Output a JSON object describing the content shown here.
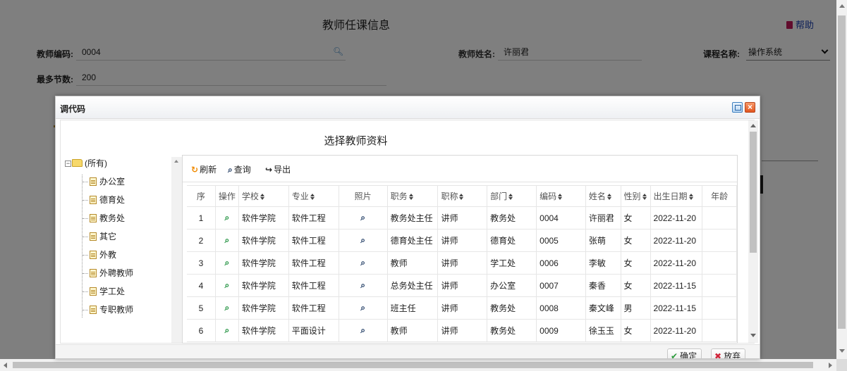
{
  "page": {
    "title": "教师任课信息",
    "help_label": "帮助",
    "fields": {
      "teacher_code_label": "教师编码:",
      "teacher_code_value": "0004",
      "teacher_name_label": "教师姓名:",
      "teacher_name_value": "许丽君",
      "course_label": "课程名称:",
      "course_value": "操作系统",
      "max_sessions_label": "最多节数:",
      "max_sessions_value": "200"
    }
  },
  "dialog": {
    "title": "调代码",
    "inner_title": "选择教师资料",
    "tree": {
      "root": "(所有)",
      "items": [
        "办公室",
        "德育处",
        "教务处",
        "其它",
        "外教",
        "外聘教师",
        "学工处",
        "专职教师"
      ]
    },
    "toolbar": {
      "refresh": "刷新",
      "query": "查询",
      "export": "导出"
    },
    "columns": [
      "序",
      "操作",
      "学校",
      "专业",
      "照片",
      "职务",
      "职称",
      "部门",
      "编码",
      "姓名",
      "性别",
      "出生日期",
      "年龄"
    ],
    "rows": [
      {
        "no": "1",
        "school": "软件学院",
        "major": "软件工程",
        "post": "教务处主任",
        "title": "讲师",
        "dept": "教务处",
        "code": "0004",
        "name": "许丽君",
        "gender": "女",
        "birth": "2022-11-20"
      },
      {
        "no": "2",
        "school": "软件学院",
        "major": "软件工程",
        "post": "德育处主任",
        "title": "讲师",
        "dept": "德育处",
        "code": "0005",
        "name": "张萌",
        "gender": "女",
        "birth": "2022-11-20"
      },
      {
        "no": "3",
        "school": "软件学院",
        "major": "软件工程",
        "post": "教师",
        "title": "讲师",
        "dept": "学工处",
        "code": "0006",
        "name": "李敏",
        "gender": "女",
        "birth": "2022-11-20"
      },
      {
        "no": "4",
        "school": "软件学院",
        "major": "软件工程",
        "post": "总务处主任",
        "title": "讲师",
        "dept": "办公室",
        "code": "0007",
        "name": "秦香",
        "gender": "女",
        "birth": "2022-11-15"
      },
      {
        "no": "5",
        "school": "软件学院",
        "major": "软件工程",
        "post": "班主任",
        "title": "讲师",
        "dept": "教务处",
        "code": "0008",
        "name": "秦文峰",
        "gender": "男",
        "birth": "2022-11-15"
      },
      {
        "no": "6",
        "school": "软件学院",
        "major": "平面设计",
        "post": "教师",
        "title": "讲师",
        "dept": "教务处",
        "code": "0009",
        "name": "徐玉玉",
        "gender": "女",
        "birth": "2022-11-20"
      }
    ],
    "footer": {
      "ok": "确定",
      "cancel": "放弃"
    }
  },
  "icons": {
    "refresh": "refresh-icon",
    "query": "search-icon",
    "export": "export-icon",
    "row_action": "view-icon",
    "photo": "photo-search-icon"
  },
  "colors": {
    "refresh_icon": "#f08a00",
    "row_action_icon": "#1a8f3a",
    "help_book": "#c2185b",
    "close_button": "#e2551e"
  }
}
